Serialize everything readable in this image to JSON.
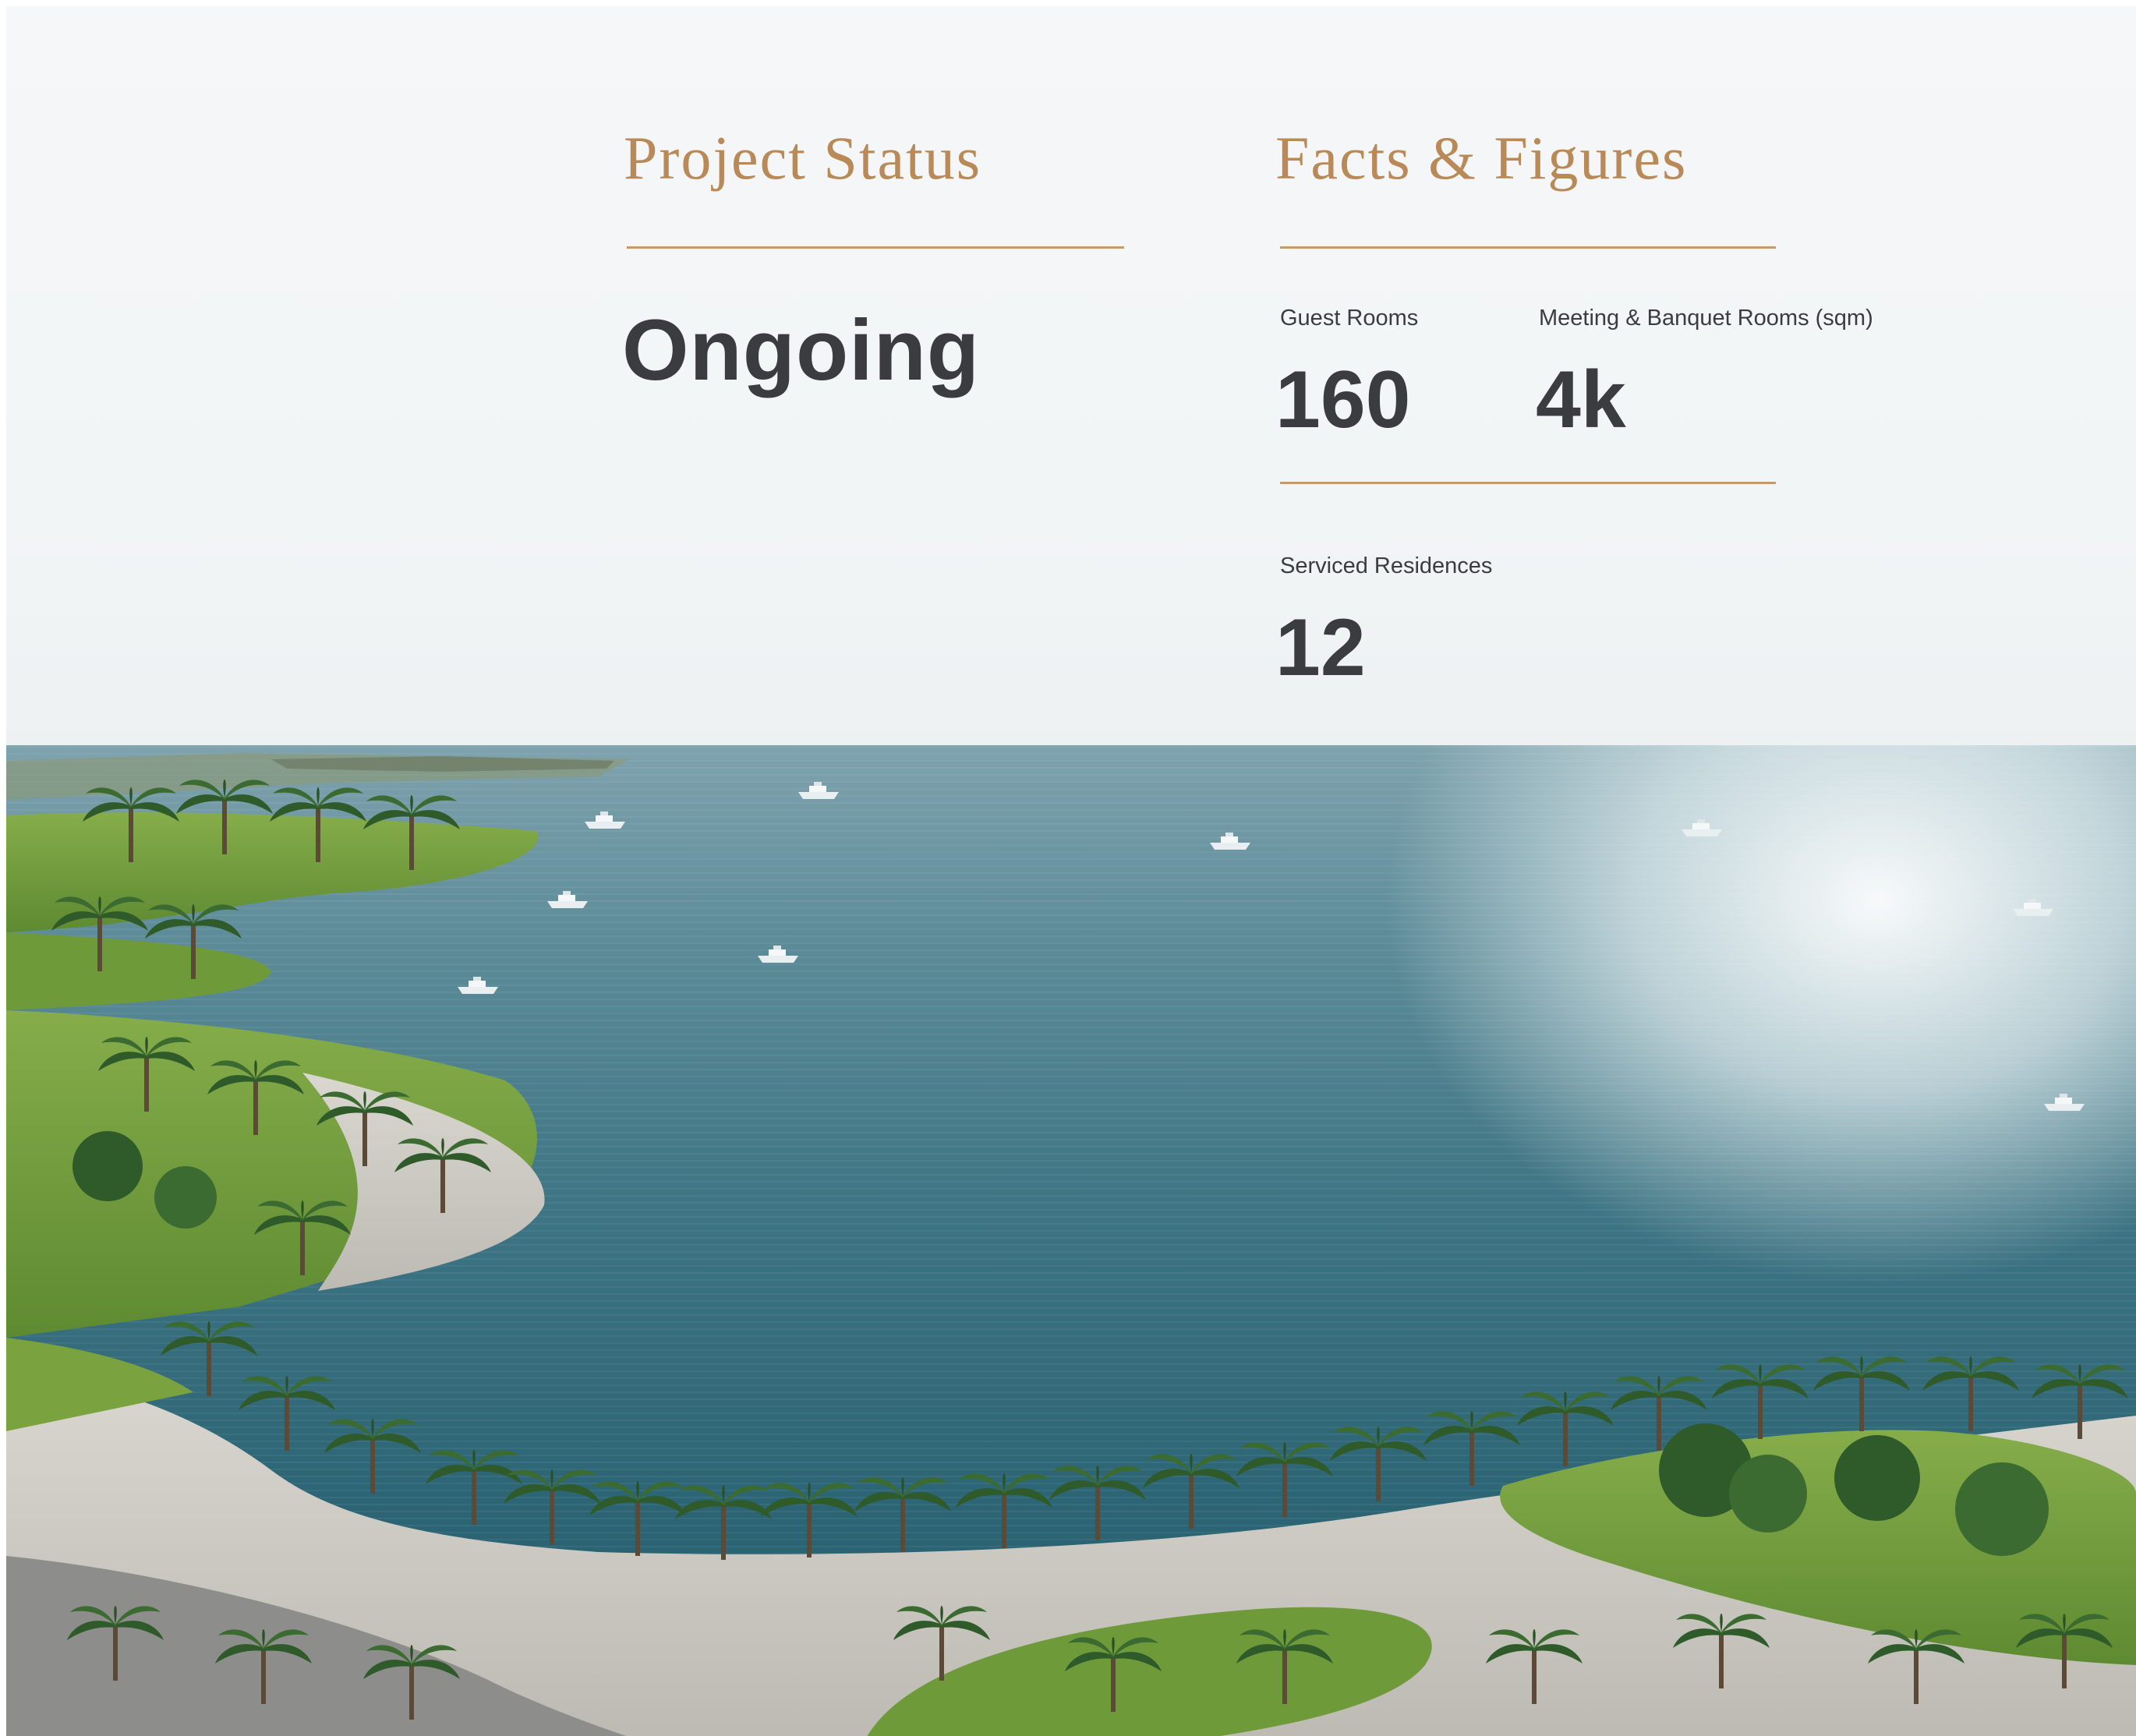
{
  "project_status": {
    "heading": "Project Status",
    "value": "Ongoing"
  },
  "facts": {
    "heading": "Facts & Figures",
    "items": [
      {
        "label": "Guest Rooms",
        "value": "160"
      },
      {
        "label": "Meeting & Banquet Rooms (sqm)",
        "value": "4k"
      },
      {
        "label": "Serviced Residences",
        "value": "12"
      }
    ]
  },
  "colors": {
    "accent": "#b98a58",
    "text": "#3b3c3f",
    "sea": "#2c6575",
    "lawn": "#6f9a3a",
    "promenade": "#cfcdc6"
  }
}
